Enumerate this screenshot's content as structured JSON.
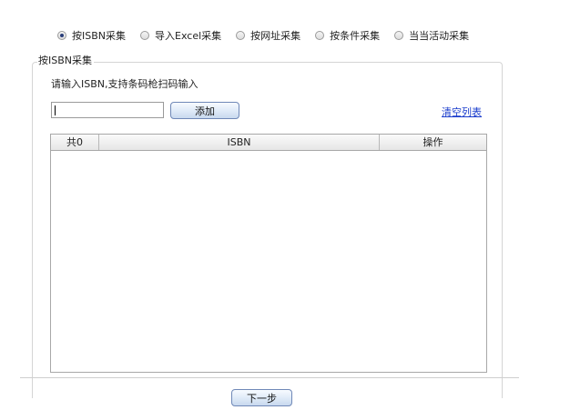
{
  "modes": [
    {
      "label": "按ISBN采集",
      "checked": true
    },
    {
      "label": "导入Excel采集",
      "checked": false
    },
    {
      "label": "按网址采集",
      "checked": false
    },
    {
      "label": "按条件采集",
      "checked": false
    },
    {
      "label": "当当活动采集",
      "checked": false
    }
  ],
  "group": {
    "legend": "按ISBN采集",
    "prompt": "请输入ISBN,支持条码枪扫码输入"
  },
  "isbn_input": {
    "value": "",
    "placeholder": ""
  },
  "add_label": "添加",
  "clear_label": "清空列表",
  "table": {
    "count_header": "共0",
    "isbn_header": "ISBN",
    "action_header": "操作",
    "rows": []
  },
  "next_label": "下一步"
}
